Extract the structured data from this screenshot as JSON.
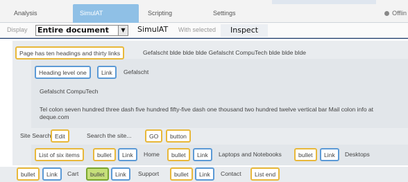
{
  "tabs": [
    {
      "label": "Analysis"
    },
    {
      "label": "SimulAT"
    },
    {
      "label": "Scripting"
    },
    {
      "label": "Settings"
    }
  ],
  "status": {
    "label": "Offlin"
  },
  "toolbar": {
    "display_label": "Display",
    "display_value": "Entire document",
    "title": "SimulAT",
    "with_selected_label": "With selected",
    "inspect_label": "Inspect"
  },
  "content": {
    "page_summary": "Page has ten headings and thirty links",
    "heading_text": "Gefalscht blde blde blde Gefalscht CompuTech blde blde blde",
    "heading_level": "Heading level one",
    "link_label": "Link",
    "heading_link_text": "Gefalscht",
    "company": "Gefalscht CompuTech",
    "contact_line": "Tel colon seven hundred three dash five hundred fifty-five dash one thousand two hundred twelve vertical bar Mail colon info at deque.com",
    "search_label": "Site Search",
    "edit_label": "Edit",
    "search_placeholder": "Search the site...",
    "go_label": "GO",
    "button_label": "button",
    "list_label": "List of six items",
    "bullet_label": "bullet",
    "nav": [
      "Home",
      "Laptops and Notebooks",
      "Desktops",
      "Cart",
      "Support",
      "Contact"
    ],
    "list_end": "List end"
  }
}
